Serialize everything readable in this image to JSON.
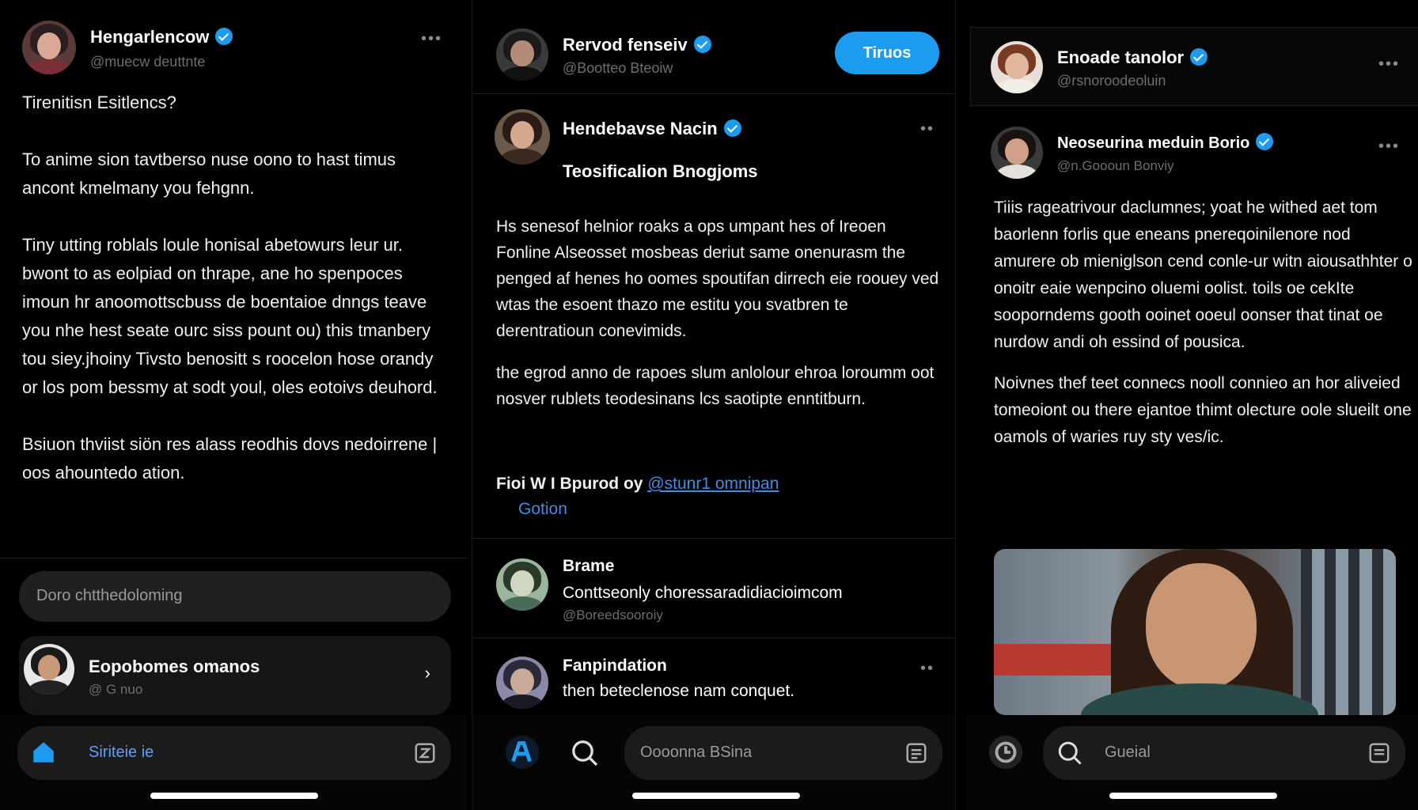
{
  "colors": {
    "accent": "#1d9bf0",
    "background": "#000000",
    "muted": "#6e6e6e",
    "link": "#3d8ee6"
  },
  "panel1": {
    "author": {
      "name": "Hengarlencow",
      "handle": "@muecw deuttnte"
    },
    "post_title": "Tirenitisn Esitlencs?",
    "paragraphs": [
      "To anime sion tavtberso nuse oono to hast timus ancont kmelmany you fehgnn.",
      "Tiny utting roblals loule honisal abetowurs leur ur. bwont to as eolpiad on thrape, ane ho spenpoces imoun hr anoomottscbuss de boentaioe dnngs teave you nhe hest seate ourc siss pount ou) this tmanbery tou siey.jhoiny Tivsto benositt s roocelon hose orandy or los pom bessmy at sodt youl, oles eotoivs deuhord.",
      "Bsiuon thviist siön res alass reodhis dovs nedoirrene | oos ahountedo ation."
    ],
    "reply_placeholder": "Doro chtthedoloming",
    "suggest": {
      "name": "Eopobomes omanos",
      "handle": "@ G nuo"
    },
    "search_label": "Siriteie ie"
  },
  "panel2": {
    "header": {
      "name": "Rervod fenseiv",
      "handle": "@Bootteo Bteoiw",
      "button": "Tiruos"
    },
    "post": {
      "author": "Hendebavse Nacin",
      "title": "Teosificalion Bnogjoms",
      "paragraphs": [
        "Hs senesof helnior roaks a ops umpant hes of Ireoen Fonline Alseosset mosbeas deriut same onenurasm the penged af henes ho oomes spoutifan dirrech eie roouey ved wtas the esoent thazo me estitu you svatbren te derentratioun conevimids.",
        "the egrod anno de rapoes slum anlolour ehroa loroumm oot nosver rublets teodesinans lcs saotipte enntitburn."
      ],
      "footer_prefix": "Fioi W I Bpurod oy",
      "footer_link": "@stunr1 omnipan",
      "footer_link2": "Gotion"
    },
    "items": [
      {
        "name": "Brame",
        "text": "Conttseonly choressaradidiacioimcom",
        "sub": "@Boreedsooroiy"
      },
      {
        "name": "Fanpindation",
        "text": "then beteclenose nam conquet."
      }
    ],
    "search_placeholder": "Oooonna BSina"
  },
  "panel3": {
    "header": {
      "name": "Enoade tanolor",
      "handle": "@rsnoroodeoluin"
    },
    "post": {
      "author": "Neoseurina meduin Borio",
      "handle": "@n.Goooun Bonviy",
      "paragraphs": [
        "Tiiis rageatrivour daclumnes; yoat he withed aet tom baorlenn forlis que eneans pnereqoinilenore nod amurere ob mieniglson cend conle-ur witn aiousathhter o onoitr eaie wenpcino oluemi oolist. toils oe cekIte sooporndems gooth ooinet ooeul oonser that tinat oe nurdow andi oh essind of pousica.",
        "Noivnes thef teet connecs nooll connieo an hor aliveied tomeoiont ou there ejantoe thimt olecture oole slueilt one oamols of waries ruy sty ves/ic."
      ]
    },
    "search_placeholder": "Gueial"
  }
}
